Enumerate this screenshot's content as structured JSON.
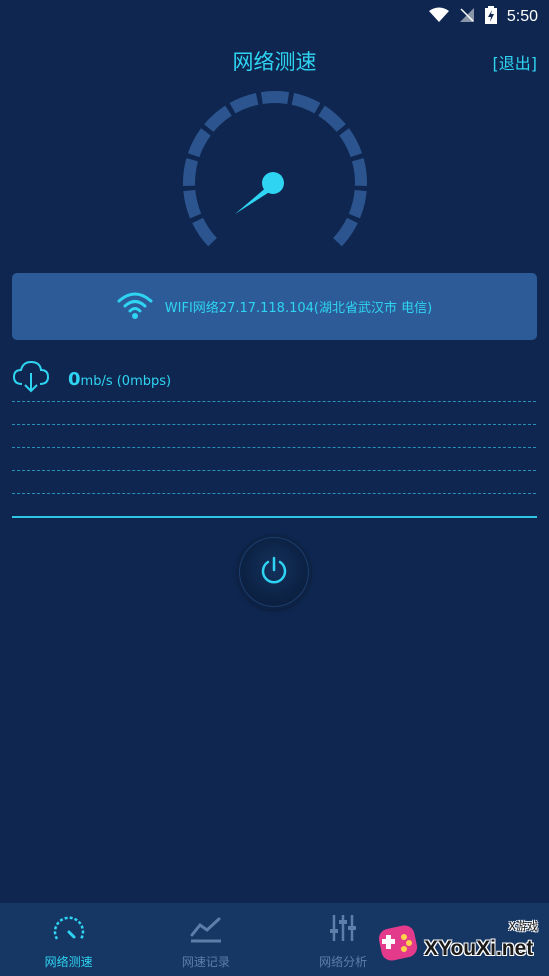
{
  "status_bar": {
    "time": "5:50"
  },
  "header": {
    "title": "网络测速",
    "exit_label": "[退出]"
  },
  "gauge": {
    "level": 0
  },
  "network": {
    "info": "WIFI网络27.17.118.104(湖北省武汉市 电信)"
  },
  "speed": {
    "value": "0",
    "unit_text": "mb/s (0mbps)"
  },
  "nav": {
    "items": [
      {
        "label": "网络测速",
        "icon": "speedometer-icon",
        "active": true
      },
      {
        "label": "网速记录",
        "icon": "chart-icon",
        "active": false
      },
      {
        "label": "网络分析",
        "icon": "sliders-icon",
        "active": false
      }
    ]
  },
  "watermark": {
    "text": "XYouXi.net",
    "small": "X游戏"
  },
  "colors": {
    "accent": "#2fd4f2",
    "background": "#0f2750",
    "card": "#2c5b98",
    "gauge_segment": "#2c5590"
  }
}
